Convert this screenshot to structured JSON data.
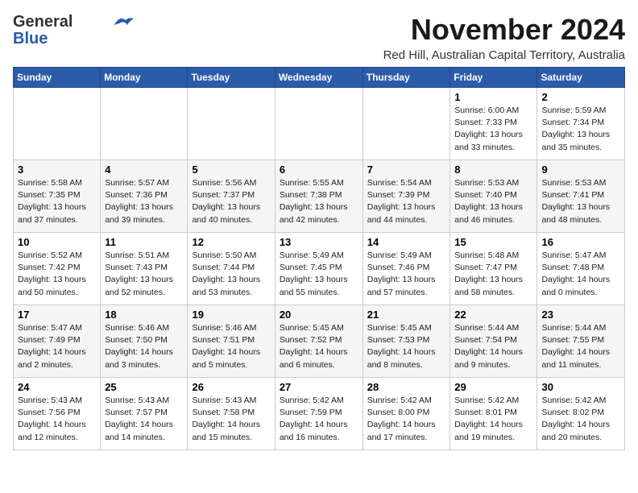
{
  "logo": {
    "general": "General",
    "blue": "Blue"
  },
  "header": {
    "month": "November 2024",
    "location": "Red Hill, Australian Capital Territory, Australia"
  },
  "weekdays": [
    "Sunday",
    "Monday",
    "Tuesday",
    "Wednesday",
    "Thursday",
    "Friday",
    "Saturday"
  ],
  "weeks": [
    [
      {
        "day": "",
        "info": ""
      },
      {
        "day": "",
        "info": ""
      },
      {
        "day": "",
        "info": ""
      },
      {
        "day": "",
        "info": ""
      },
      {
        "day": "",
        "info": ""
      },
      {
        "day": "1",
        "info": "Sunrise: 6:00 AM\nSunset: 7:33 PM\nDaylight: 13 hours\nand 33 minutes."
      },
      {
        "day": "2",
        "info": "Sunrise: 5:59 AM\nSunset: 7:34 PM\nDaylight: 13 hours\nand 35 minutes."
      }
    ],
    [
      {
        "day": "3",
        "info": "Sunrise: 5:58 AM\nSunset: 7:35 PM\nDaylight: 13 hours\nand 37 minutes."
      },
      {
        "day": "4",
        "info": "Sunrise: 5:57 AM\nSunset: 7:36 PM\nDaylight: 13 hours\nand 39 minutes."
      },
      {
        "day": "5",
        "info": "Sunrise: 5:56 AM\nSunset: 7:37 PM\nDaylight: 13 hours\nand 40 minutes."
      },
      {
        "day": "6",
        "info": "Sunrise: 5:55 AM\nSunset: 7:38 PM\nDaylight: 13 hours\nand 42 minutes."
      },
      {
        "day": "7",
        "info": "Sunrise: 5:54 AM\nSunset: 7:39 PM\nDaylight: 13 hours\nand 44 minutes."
      },
      {
        "day": "8",
        "info": "Sunrise: 5:53 AM\nSunset: 7:40 PM\nDaylight: 13 hours\nand 46 minutes."
      },
      {
        "day": "9",
        "info": "Sunrise: 5:53 AM\nSunset: 7:41 PM\nDaylight: 13 hours\nand 48 minutes."
      }
    ],
    [
      {
        "day": "10",
        "info": "Sunrise: 5:52 AM\nSunset: 7:42 PM\nDaylight: 13 hours\nand 50 minutes."
      },
      {
        "day": "11",
        "info": "Sunrise: 5:51 AM\nSunset: 7:43 PM\nDaylight: 13 hours\nand 52 minutes."
      },
      {
        "day": "12",
        "info": "Sunrise: 5:50 AM\nSunset: 7:44 PM\nDaylight: 13 hours\nand 53 minutes."
      },
      {
        "day": "13",
        "info": "Sunrise: 5:49 AM\nSunset: 7:45 PM\nDaylight: 13 hours\nand 55 minutes."
      },
      {
        "day": "14",
        "info": "Sunrise: 5:49 AM\nSunset: 7:46 PM\nDaylight: 13 hours\nand 57 minutes."
      },
      {
        "day": "15",
        "info": "Sunrise: 5:48 AM\nSunset: 7:47 PM\nDaylight: 13 hours\nand 58 minutes."
      },
      {
        "day": "16",
        "info": "Sunrise: 5:47 AM\nSunset: 7:48 PM\nDaylight: 14 hours\nand 0 minutes."
      }
    ],
    [
      {
        "day": "17",
        "info": "Sunrise: 5:47 AM\nSunset: 7:49 PM\nDaylight: 14 hours\nand 2 minutes."
      },
      {
        "day": "18",
        "info": "Sunrise: 5:46 AM\nSunset: 7:50 PM\nDaylight: 14 hours\nand 3 minutes."
      },
      {
        "day": "19",
        "info": "Sunrise: 5:46 AM\nSunset: 7:51 PM\nDaylight: 14 hours\nand 5 minutes."
      },
      {
        "day": "20",
        "info": "Sunrise: 5:45 AM\nSunset: 7:52 PM\nDaylight: 14 hours\nand 6 minutes."
      },
      {
        "day": "21",
        "info": "Sunrise: 5:45 AM\nSunset: 7:53 PM\nDaylight: 14 hours\nand 8 minutes."
      },
      {
        "day": "22",
        "info": "Sunrise: 5:44 AM\nSunset: 7:54 PM\nDaylight: 14 hours\nand 9 minutes."
      },
      {
        "day": "23",
        "info": "Sunrise: 5:44 AM\nSunset: 7:55 PM\nDaylight: 14 hours\nand 11 minutes."
      }
    ],
    [
      {
        "day": "24",
        "info": "Sunrise: 5:43 AM\nSunset: 7:56 PM\nDaylight: 14 hours\nand 12 minutes."
      },
      {
        "day": "25",
        "info": "Sunrise: 5:43 AM\nSunset: 7:57 PM\nDaylight: 14 hours\nand 14 minutes."
      },
      {
        "day": "26",
        "info": "Sunrise: 5:43 AM\nSunset: 7:58 PM\nDaylight: 14 hours\nand 15 minutes."
      },
      {
        "day": "27",
        "info": "Sunrise: 5:42 AM\nSunset: 7:59 PM\nDaylight: 14 hours\nand 16 minutes."
      },
      {
        "day": "28",
        "info": "Sunrise: 5:42 AM\nSunset: 8:00 PM\nDaylight: 14 hours\nand 17 minutes."
      },
      {
        "day": "29",
        "info": "Sunrise: 5:42 AM\nSunset: 8:01 PM\nDaylight: 14 hours\nand 19 minutes."
      },
      {
        "day": "30",
        "info": "Sunrise: 5:42 AM\nSunset: 8:02 PM\nDaylight: 14 hours\nand 20 minutes."
      }
    ]
  ]
}
